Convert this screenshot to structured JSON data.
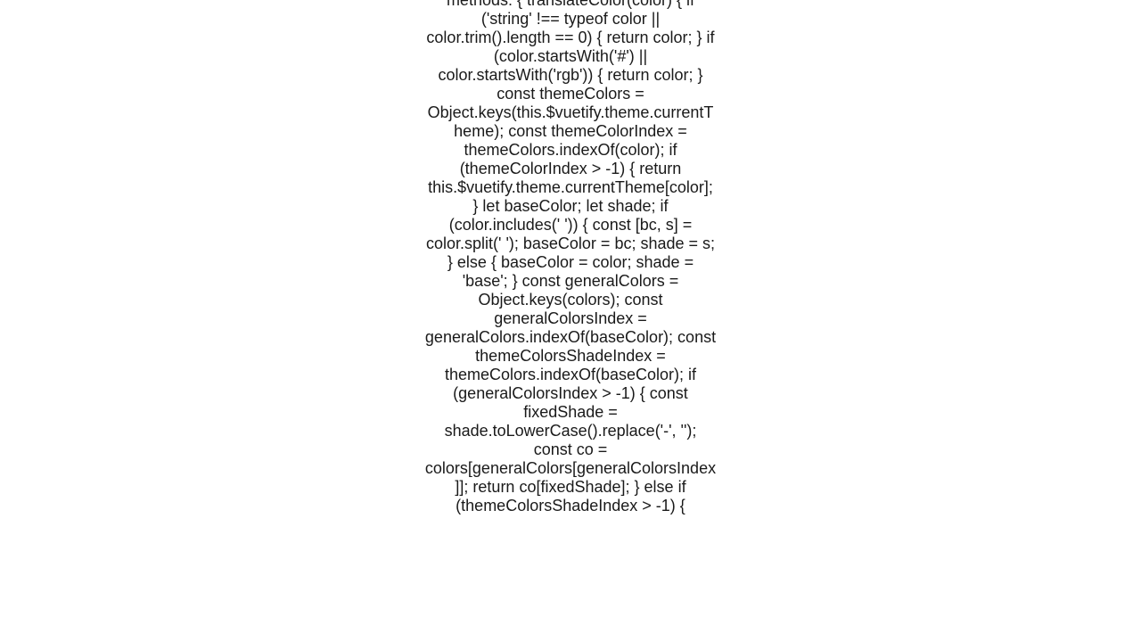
{
  "code_text": "methods: {      translateColor(color) {          if ('string' !== typeof color || color.trim().length == 0) {              return color;          }          if (color.startsWith('#') || color.startsWith('rgb')) {              return color;          }          const themeColors = Object.keys(this.$vuetify.theme.currentTheme);          const themeColorIndex = themeColors.indexOf(color);          if (themeColorIndex > -1) {              return this.$vuetify.theme.currentTheme[color];          }          let baseColor;          let shade;          if (color.includes(' ')) {              const [bc, s] = color.split(' ');              baseColor = bc;              shade = s;          }          else {              baseColor = color;              shade = 'base';          }          const generalColors = Object.keys(colors);          const generalColorsIndex = generalColors.indexOf(baseColor);          const themeColorsShadeIndex = themeColors.indexOf(baseColor);          if (generalColorsIndex > -1) {              const fixedShade = shade.toLowerCase().replace('-', '');              const co = colors[generalColors[generalColorsIndex]];              return co[fixedShade];          }          else if (themeColorsShadeIndex > -1) {"
}
